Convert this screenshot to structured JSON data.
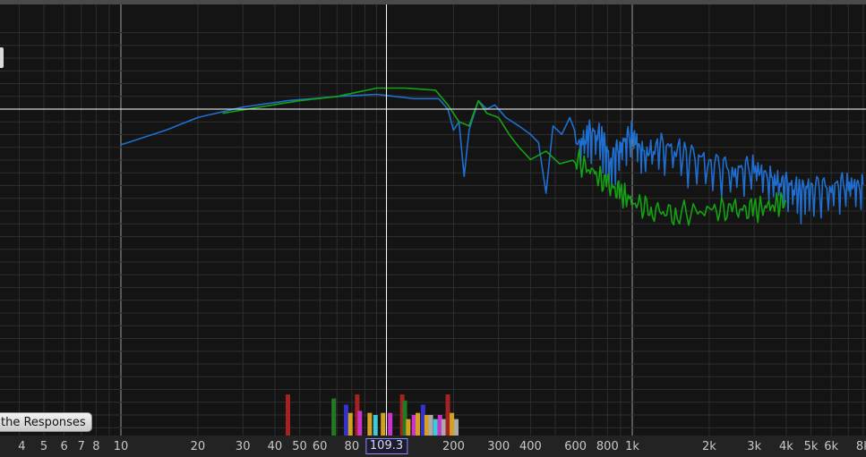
{
  "buttons": {
    "responses_label": "the Responses"
  },
  "cursor": {
    "readout": "109.3",
    "freq_hz": 109.3
  },
  "axis": {
    "x_ticks": [
      {
        "label": "4",
        "hz": 4.1
      },
      {
        "label": "5",
        "hz": 5
      },
      {
        "label": "6",
        "hz": 6
      },
      {
        "label": "7",
        "hz": 7
      },
      {
        "label": "8",
        "hz": 8
      },
      {
        "label": "10",
        "hz": 10
      },
      {
        "label": "20",
        "hz": 20
      },
      {
        "label": "30",
        "hz": 30
      },
      {
        "label": "40",
        "hz": 40
      },
      {
        "label": "50",
        "hz": 50
      },
      {
        "label": "60",
        "hz": 60
      },
      {
        "label": "80",
        "hz": 80
      },
      {
        "label": "200",
        "hz": 200
      },
      {
        "label": "300",
        "hz": 300
      },
      {
        "label": "400",
        "hz": 400
      },
      {
        "label": "600",
        "hz": 600
      },
      {
        "label": "800",
        "hz": 800
      },
      {
        "label": "1k",
        "hz": 1000
      },
      {
        "label": "2k",
        "hz": 2000
      },
      {
        "label": "3k",
        "hz": 3000
      },
      {
        "label": "4k",
        "hz": 4000
      },
      {
        "label": "5k",
        "hz": 5000
      },
      {
        "label": "6k",
        "hz": 6000
      },
      {
        "label": "8k",
        "hz": 8000
      }
    ]
  },
  "colors": {
    "background": "#141414",
    "grid_minor": "#2e2e2e",
    "grid_major": "#9a9a9a",
    "cursor": "#ffffff",
    "series_blue": "#1f6fd1",
    "series_green": "#13a313"
  },
  "chart_data": {
    "type": "line",
    "x_scale": "log",
    "xlim": [
      3.3,
      8300
    ],
    "x_unit": "Hz",
    "series": [
      {
        "color": "#1f6fd1",
        "points": [
          [
            10,
            -8.5
          ],
          [
            15,
            -5
          ],
          [
            20,
            -2
          ],
          [
            30,
            0.5
          ],
          [
            45,
            2
          ],
          [
            70,
            3
          ],
          [
            100,
            3.5
          ],
          [
            140,
            2.5
          ],
          [
            175,
            2.5
          ],
          [
            190,
            0
          ],
          [
            200,
            -5
          ],
          [
            210,
            -3
          ],
          [
            220,
            -16
          ],
          [
            230,
            -5
          ],
          [
            250,
            2
          ],
          [
            270,
            0
          ],
          [
            290,
            1
          ],
          [
            320,
            -2
          ],
          [
            360,
            -4
          ],
          [
            400,
            -6
          ],
          [
            430,
            -8
          ],
          [
            460,
            -20
          ],
          [
            490,
            -4
          ],
          [
            530,
            -6
          ],
          [
            570,
            -2
          ],
          [
            620,
            -8
          ],
          [
            680,
            -5
          ],
          [
            760,
            -6
          ],
          [
            820,
            -12
          ],
          [
            900,
            -8
          ],
          [
            1000,
            -5
          ],
          [
            1100,
            -10
          ],
          [
            1300,
            -8
          ],
          [
            1600,
            -10
          ],
          [
            2000,
            -12
          ],
          [
            2500,
            -14
          ],
          [
            3000,
            -13
          ],
          [
            3500,
            -16
          ],
          [
            4000,
            -17
          ],
          [
            4500,
            -19
          ],
          [
            5000,
            -18
          ],
          [
            6000,
            -18
          ],
          [
            7000,
            -17
          ],
          [
            8000,
            -18
          ]
        ]
      },
      {
        "color": "#13a313",
        "points": [
          [
            25,
            -1
          ],
          [
            35,
            0.5
          ],
          [
            50,
            2
          ],
          [
            70,
            3
          ],
          [
            100,
            5
          ],
          [
            130,
            5
          ],
          [
            170,
            4.5
          ],
          [
            190,
            1
          ],
          [
            210,
            -3
          ],
          [
            230,
            -4
          ],
          [
            250,
            2
          ],
          [
            270,
            -1
          ],
          [
            300,
            -2
          ],
          [
            330,
            -6
          ],
          [
            360,
            -9
          ],
          [
            400,
            -12
          ],
          [
            460,
            -10
          ],
          [
            520,
            -13
          ],
          [
            600,
            -12
          ],
          [
            700,
            -15
          ],
          [
            800,
            -18
          ],
          [
            900,
            -20
          ],
          [
            1000,
            -22
          ],
          [
            1200,
            -24
          ],
          [
            1500,
            -25
          ],
          [
            2000,
            -24
          ],
          [
            2500,
            -24
          ],
          [
            3000,
            -24
          ],
          [
            3500,
            -23
          ],
          [
            4000,
            -22
          ]
        ]
      }
    ],
    "markers": [
      {
        "hz": 45,
        "color": "#a42222",
        "value": 1.0
      },
      {
        "hz": 68,
        "color": "#237a23",
        "value": 0.9
      },
      {
        "hz": 76,
        "color": "#3333cc",
        "value": 0.75
      },
      {
        "hz": 79,
        "color": "#d4a020",
        "value": 0.55
      },
      {
        "hz": 84,
        "color": "#a42222",
        "value": 1.0
      },
      {
        "hz": 86,
        "color": "#cc33cc",
        "value": 0.6
      },
      {
        "hz": 94,
        "color": "#d4a020",
        "value": 0.55
      },
      {
        "hz": 99,
        "color": "#40c8d8",
        "value": 0.5
      },
      {
        "hz": 106,
        "color": "#d4a020",
        "value": 0.55
      },
      {
        "hz": 113,
        "color": "#cc33cc",
        "value": 0.55
      },
      {
        "hz": 126,
        "color": "#a42222",
        "value": 1.0
      },
      {
        "hz": 129,
        "color": "#237a23",
        "value": 0.85
      },
      {
        "hz": 133,
        "color": "#d4a020",
        "value": 0.4
      },
      {
        "hz": 140,
        "color": "#cc33cc",
        "value": 0.5
      },
      {
        "hz": 145,
        "color": "#d4a020",
        "value": 0.55
      },
      {
        "hz": 152,
        "color": "#3333cc",
        "value": 0.75
      },
      {
        "hz": 157,
        "color": "#d4a020",
        "value": 0.5
      },
      {
        "hz": 163,
        "color": "#aaaaaa",
        "value": 0.5
      },
      {
        "hz": 170,
        "color": "#40c8d8",
        "value": 0.4
      },
      {
        "hz": 177,
        "color": "#cc33cc",
        "value": 0.5
      },
      {
        "hz": 183,
        "color": "#aaaaaa",
        "value": 0.4
      },
      {
        "hz": 190,
        "color": "#a42222",
        "value": 1.0
      },
      {
        "hz": 197,
        "color": "#d4a020",
        "value": 0.55
      },
      {
        "hz": 205,
        "color": "#aaaaaa",
        "value": 0.4
      }
    ]
  }
}
